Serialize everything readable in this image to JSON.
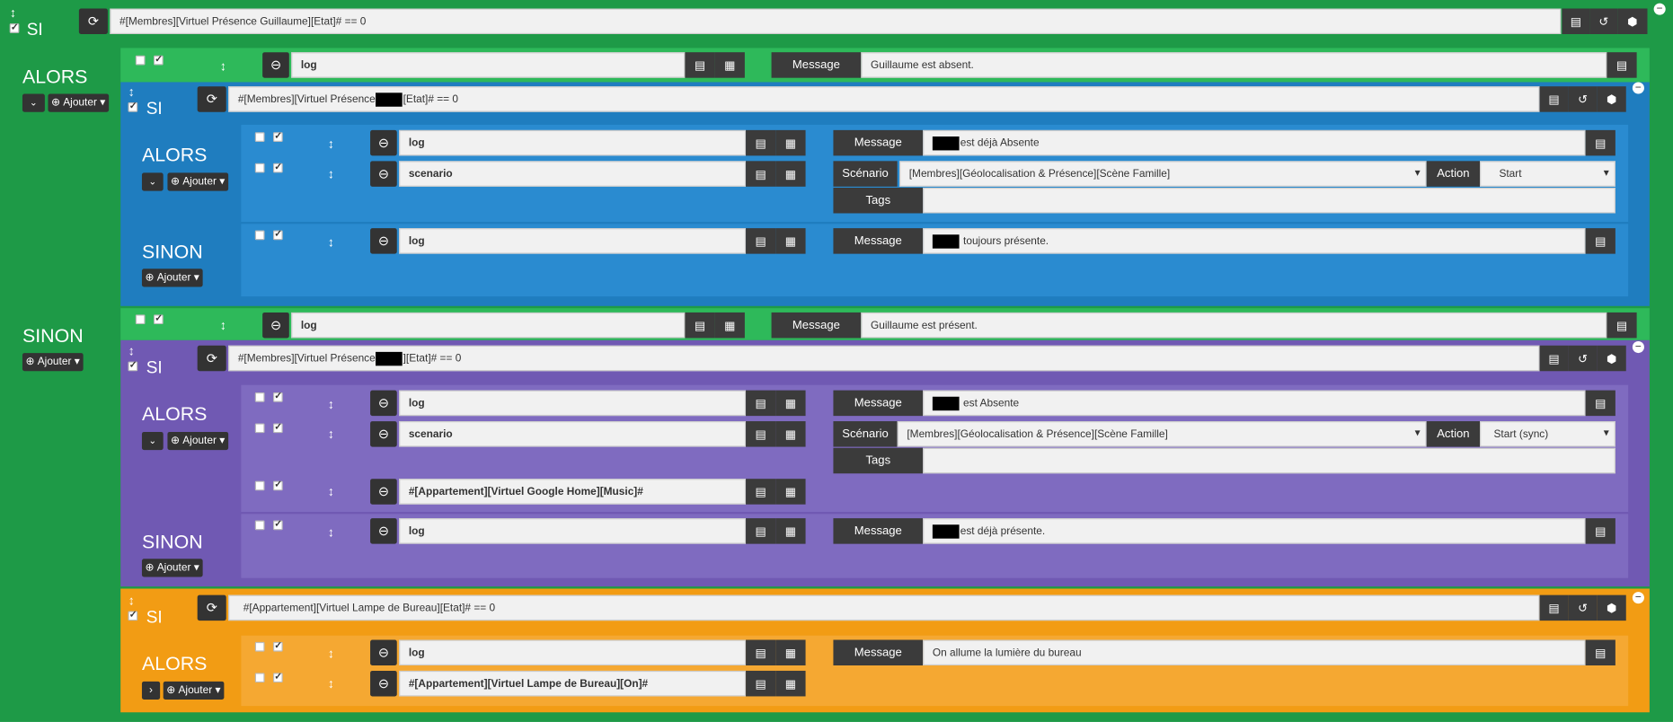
{
  "colors": {
    "green": "#1e9a47",
    "green_inner": "#2eb95a",
    "blue": "#1f7dbf",
    "purple": "#7059b3",
    "orange": "#f29c14",
    "dark": "#3b3b3b"
  },
  "labels": {
    "si": "SI",
    "alors": "ALORS",
    "sinon": "SINON",
    "add": "Ajouter",
    "message": "Message",
    "scenario": "Scénario",
    "action": "Action",
    "tags": "Tags"
  },
  "root": {
    "condition": "#[Membres][Virtuel Présence Guillaume][Etat]# == 0",
    "alors_action": {
      "command": "log",
      "message": "Guillaume est absent."
    },
    "sinon_action": {
      "command": "log",
      "message": "Guillaume est présent."
    }
  },
  "blue": {
    "condition_pre": "#[Membres][Virtuel Présence",
    "condition_post": "[Etat]# == 0",
    "alors": [
      {
        "command": "log",
        "message": "est déjà Absente"
      },
      {
        "command": "scenario",
        "scenario": "[Membres][Géolocalisation & Présence][Scène Famille]",
        "action": "Start"
      }
    ],
    "sinon": [
      {
        "command": "log",
        "message": "toujours présente."
      }
    ]
  },
  "purple": {
    "condition_pre": "#[Membres][Virtuel Présence",
    "condition_post": "][Etat]# == 0",
    "alors": [
      {
        "command": "log",
        "message": "est Absente"
      },
      {
        "command": "scenario",
        "scenario": "[Membres][Géolocalisation & Présence][Scène Famille]",
        "action": "Start (sync)"
      },
      {
        "command": "#[Appartement][Virtuel Google Home][Music]#"
      }
    ],
    "sinon": [
      {
        "command": "log",
        "message": "est déjà présente."
      }
    ]
  },
  "orange": {
    "condition": "#[Appartement][Virtuel Lampe de Bureau][Etat]# == 0",
    "alors": [
      {
        "command": "log",
        "message": "On allume la lumière du bureau"
      },
      {
        "command": "#[Appartement][Virtuel Lampe de Bureau][On]#"
      }
    ]
  },
  "icons": [
    "refresh-icon",
    "expand-icon",
    "history-icon",
    "copy-icon",
    "code-icon",
    "minus-circle-icon",
    "drag-icon",
    "chevron-icon",
    "plus-icon"
  ]
}
